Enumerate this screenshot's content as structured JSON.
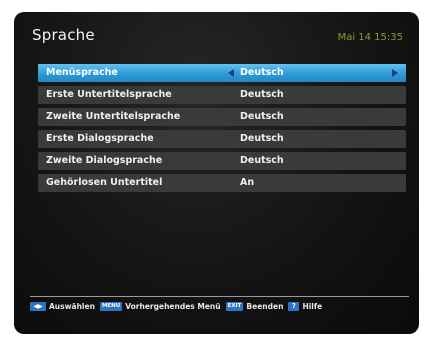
{
  "header": {
    "title": "Sprache",
    "datetime": "Mai 14 15:35"
  },
  "menu": {
    "items": [
      {
        "label": "Menüsprache",
        "value": "Deutsch",
        "selected": true
      },
      {
        "label": "Erste Untertitelsprache",
        "value": "Deutsch",
        "selected": false
      },
      {
        "label": "Zweite Untertitelsprache",
        "value": "Deutsch",
        "selected": false
      },
      {
        "label": "Erste Dialogsprache",
        "value": "Deutsch",
        "selected": false
      },
      {
        "label": "Zweite Dialogsprache",
        "value": "Deutsch",
        "selected": false
      },
      {
        "label": "Gehörlosen Untertitel",
        "value": "An",
        "selected": false
      }
    ]
  },
  "footer": {
    "select_key": "◀▶",
    "select_label": "Auswählen",
    "menu_key": "MENU",
    "menu_label": "Vorhergehendes Menü",
    "exit_key": "EXIT",
    "exit_label": "Beenden",
    "help_key": "?",
    "help_label": "Hilfe"
  },
  "colors": {
    "highlight": "#2b9ad6",
    "row_bg": "#3a3a3a",
    "clock": "#8e9a2e",
    "key_bg": "#2e74c5"
  }
}
